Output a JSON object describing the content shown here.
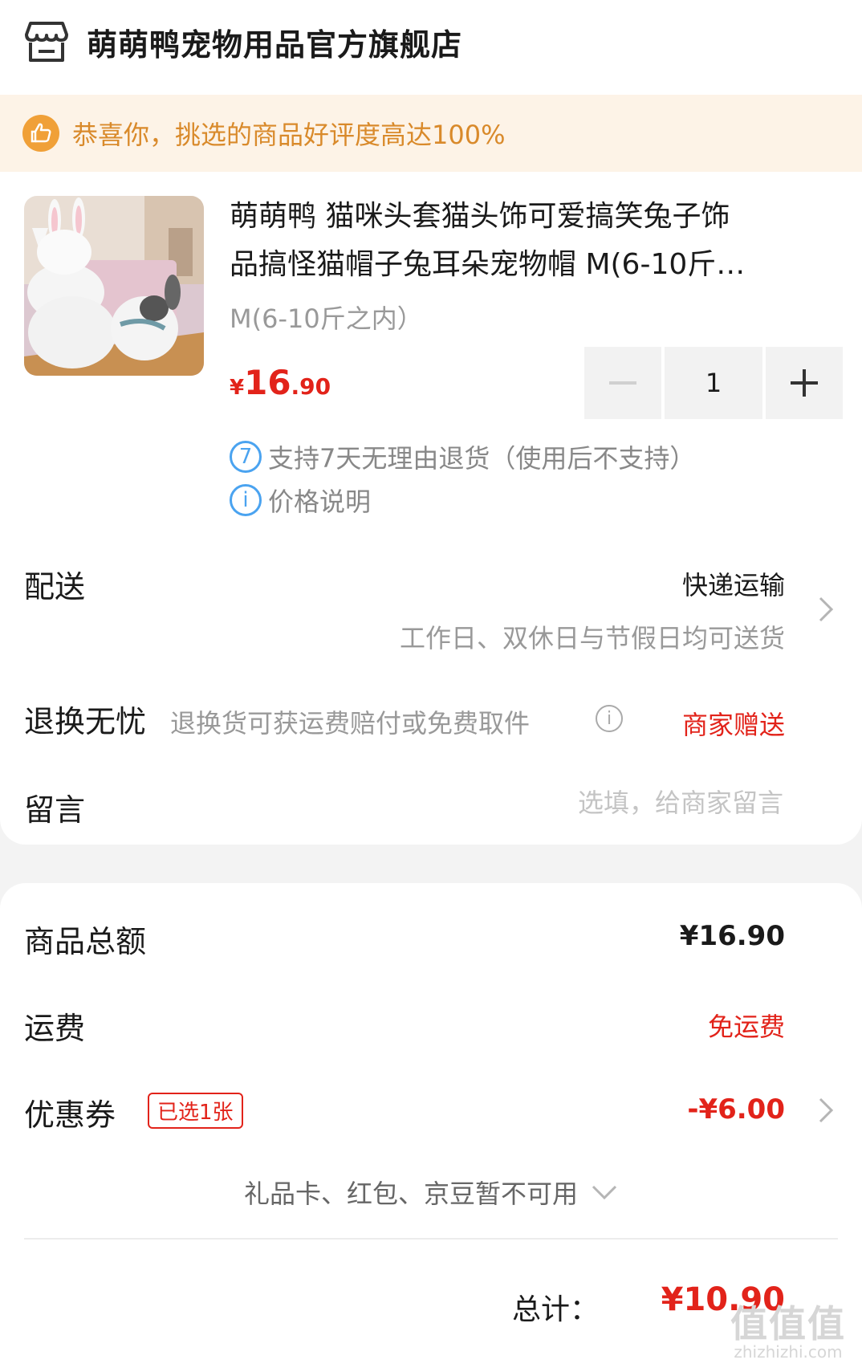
{
  "store": {
    "name": "萌萌鸭宠物用品官方旗舰店",
    "icon": "store-icon"
  },
  "banner": {
    "text": "恭喜你，挑选的商品好评度高达100%",
    "icon": "thumbs-up-icon"
  },
  "product": {
    "title_line1": "萌萌鸭 猫咪头套猫头饰可爱搞笑兔子饰",
    "title_line2": "品搞怪猫帽子兔耳朵宠物帽 M(6-10斤…",
    "spec": "M(6-10斤之内）",
    "price_symbol": "¥",
    "price_int": "16",
    "price_dec": ".90",
    "quantity": "1",
    "services": [
      {
        "badge": "7",
        "text": "支持7天无理由退货（使用后不支持）"
      },
      {
        "badge": "i",
        "text": "价格说明"
      }
    ]
  },
  "delivery": {
    "label": "配送",
    "method": "快递运输",
    "note": "工作日、双休日与节假日均可送货"
  },
  "returns": {
    "label": "退换无忧",
    "desc": "退换货可获运费赔付或免费取件",
    "value": "商家赠送"
  },
  "message": {
    "label": "留言",
    "placeholder": "选填，给商家留言"
  },
  "summary": {
    "goods_label": "商品总额",
    "goods_value": "¥16.90",
    "freight_label": "运费",
    "freight_value": "免运费",
    "coupon_label": "优惠券",
    "coupon_badge": "已选1张",
    "coupon_value": "-¥6.00",
    "unavailable": "礼品卡、红包、京豆暂不可用",
    "total_label": "总计：",
    "total_value": "¥10.90"
  },
  "watermark": {
    "logo": "值值值",
    "url": "zhizhizhi.com"
  },
  "colors": {
    "accent_red": "#e2231a",
    "banner_orange": "#d98a2b",
    "info_blue": "#4aa3f0"
  }
}
